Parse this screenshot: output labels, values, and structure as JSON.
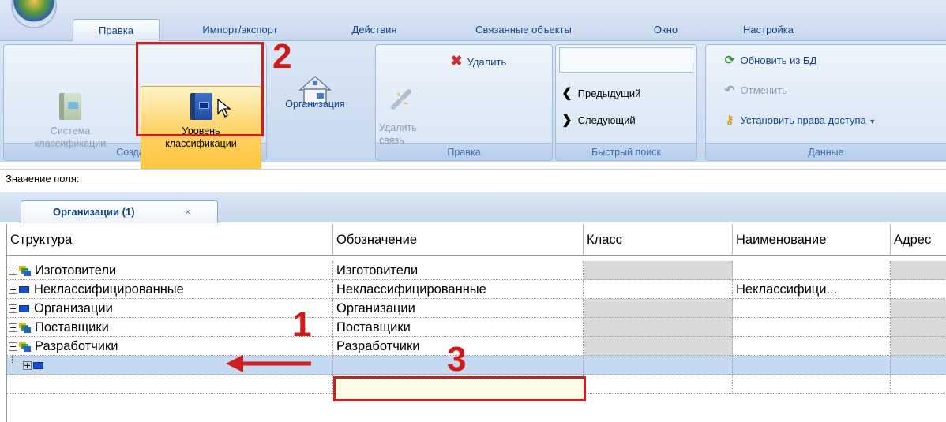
{
  "tabs": [
    "Правка",
    "Импорт/экспорт",
    "Действия",
    "Связанные объекты",
    "Окно",
    "Настройка"
  ],
  "ribbon": {
    "create": {
      "label": "Создать",
      "system_line1": "Система",
      "system_line2": "классификации",
      "level_line1": "Уровень",
      "level_line2": "классификации",
      "org": "Организация"
    },
    "edit": {
      "label": "Правка",
      "delete": "Удалить",
      "unlink_line1": "Удалить",
      "unlink_line2": "связь"
    },
    "search": {
      "label": "Быстрый поиск",
      "prev": "Предыдущий",
      "next": "Следующий",
      "input_value": ""
    },
    "data": {
      "label": "Данные",
      "refresh": "Обновить из БД",
      "cancel": "Отменить",
      "rights": "Установить права доступа"
    }
  },
  "field_value_label": "Значение поля:",
  "doc_tab": {
    "title": "Организации (1)",
    "close": "×"
  },
  "grid": {
    "columns": [
      "Структура",
      "Обозначение",
      "Класс",
      "Наименование",
      "Адрес"
    ],
    "rows": [
      {
        "structure": "Изготовители",
        "designation": "Изготовители",
        "klass": "",
        "name": "",
        "icon": "folder-icon",
        "toggle": "+"
      },
      {
        "structure": "Неклассифицированные",
        "designation": "Неклассифицированные",
        "klass": "",
        "name": "Неклассифици...",
        "icon": "level-icon",
        "toggle": "+"
      },
      {
        "structure": "Организации",
        "designation": "Организации",
        "klass": "",
        "name": "",
        "icon": "level-icon",
        "toggle": "+"
      },
      {
        "structure": "Поставщики",
        "designation": "Поставщики",
        "klass": "",
        "name": "",
        "icon": "folder-icon",
        "toggle": "+"
      },
      {
        "structure": "Разработчики",
        "designation": "Разработчики",
        "klass": "",
        "name": "",
        "icon": "folder-icon",
        "toggle": "−"
      },
      {
        "structure": "",
        "designation": "",
        "klass": "",
        "name": "",
        "icon": "level-icon",
        "toggle": "+"
      }
    ]
  },
  "annotations": {
    "one": "1",
    "two": "2",
    "three": "3"
  },
  "colors": {
    "accent_red": "#cc1f1f",
    "selection": "#c5d9f1",
    "ribbon_text": "#15428b"
  }
}
